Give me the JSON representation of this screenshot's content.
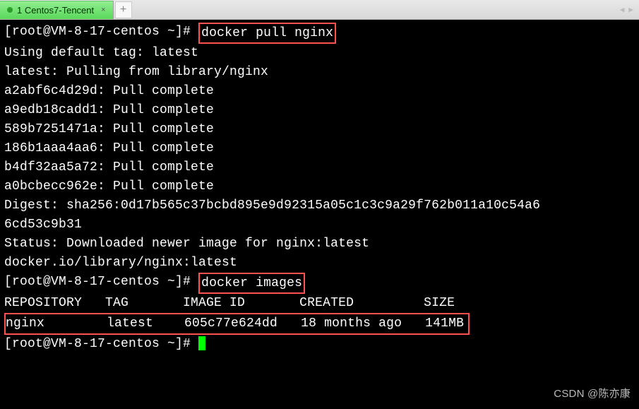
{
  "tab": {
    "title": "1 Centos7-Tencent",
    "close": "×",
    "new": "+"
  },
  "nav": {
    "left": "◀",
    "right": "▶"
  },
  "prompt": {
    "user_host": "[root@VM-8-17-centos ~]#"
  },
  "commands": {
    "pull": "docker pull nginx",
    "images": "docker images"
  },
  "output": {
    "line1": "Using default tag: latest",
    "line2": "latest: Pulling from library/nginx",
    "pulls": [
      "a2abf6c4d29d: Pull complete",
      "a9edb18cadd1: Pull complete",
      "589b7251471a: Pull complete",
      "186b1aaa4aa6: Pull complete",
      "b4df32aa5a72: Pull complete",
      "a0bcbecc962e: Pull complete"
    ],
    "digest1": "Digest: sha256:0d17b565c37bcbd895e9d92315a05c1c3c9a29f762b011a10c54a6",
    "digest2": "6cd53c9b31",
    "status": "Status: Downloaded newer image for nginx:latest",
    "image_ref": "docker.io/library/nginx:latest",
    "table_header": "REPOSITORY   TAG       IMAGE ID       CREATED         SIZE",
    "table_row": "nginx        latest    605c77e624dd   18 months ago   141MB"
  },
  "watermark": "CSDN @陈亦康"
}
